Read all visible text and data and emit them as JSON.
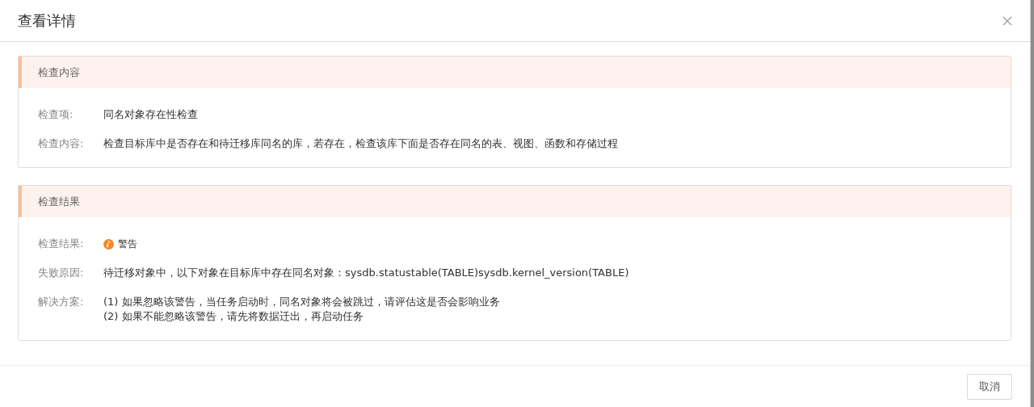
{
  "dialog": {
    "title": "查看详情"
  },
  "sections": [
    {
      "title": "检查内容",
      "rows": [
        {
          "kind": "text",
          "label": "检查项:",
          "value": "同名对象存在性检查"
        },
        {
          "kind": "text",
          "label": "检查内容:",
          "value": "检查目标库中是否存在和待迁移库同名的库，若存在，检查该库下面是否存在同名的表、视图、函数和存储过程"
        }
      ]
    },
    {
      "title": "检查结果",
      "rows": [
        {
          "kind": "status",
          "label": "检查结果:",
          "value": "警告"
        },
        {
          "kind": "text",
          "label": "失败原因:",
          "value": "待迁移对象中，以下对象在目标库中存在同名对象：sysdb.statustable(TABLE)sysdb.kernel_version(TABLE)"
        },
        {
          "kind": "lines",
          "label": "解决方案:",
          "lines": [
            "(1) 如果忽略该警告，当任务启动时，同名对象将会被跳过，请评估这是否会影响业务",
            "(2) 如果不能忽略该警告，请先将数据迁出，再启动任务"
          ]
        }
      ]
    }
  ],
  "footer": {
    "buttons": [
      "取消"
    ]
  }
}
